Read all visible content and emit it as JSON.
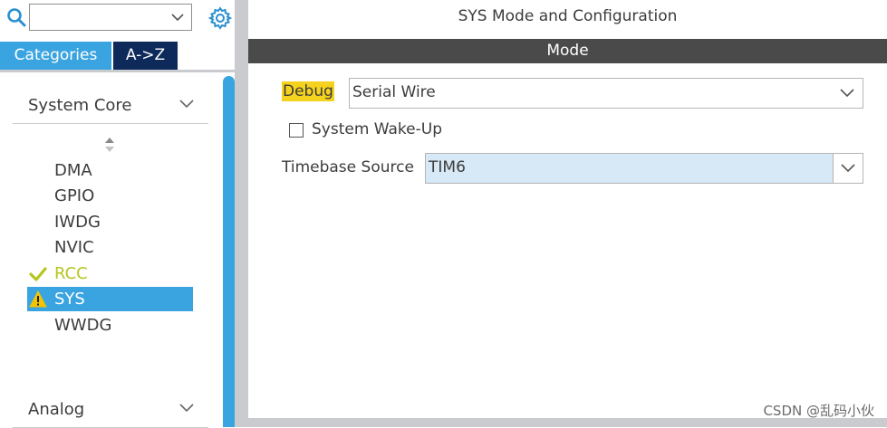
{
  "left": {
    "search": {
      "value": "",
      "placeholder": ""
    },
    "tabs": [
      {
        "label": "Categories",
        "active": true
      },
      {
        "label": "A->Z",
        "active": false
      }
    ],
    "sections": [
      {
        "title": "System Core",
        "expanded": true
      },
      {
        "title": "Analog",
        "expanded": false
      }
    ],
    "items": [
      {
        "label": "DMA",
        "state": "none"
      },
      {
        "label": "GPIO",
        "state": "none"
      },
      {
        "label": "IWDG",
        "state": "none"
      },
      {
        "label": "NVIC",
        "state": "none"
      },
      {
        "label": "RCC",
        "state": "configured",
        "icon": "checkmark-icon"
      },
      {
        "label": "SYS",
        "state": "selected-warning",
        "icon": "warning-icon"
      },
      {
        "label": "WWDG",
        "state": "none"
      }
    ]
  },
  "right": {
    "title": "SYS Mode and Configuration",
    "mode_header": "Mode",
    "debug": {
      "label": "Debug",
      "value": "Serial Wire"
    },
    "wakeup": {
      "label": "System Wake-Up",
      "checked": false
    },
    "timebase": {
      "label": "Timebase Source",
      "value": "TIM6"
    }
  },
  "watermark": "CSDN @乱码小伙",
  "colors": {
    "accent": "#3aa4e0",
    "tab_dark": "#0e2a5a",
    "mode_bar": "#4a4a4a",
    "debug_highlight": "#f5d21e",
    "configured": "#b6c61e",
    "warning": "#f2c500"
  }
}
